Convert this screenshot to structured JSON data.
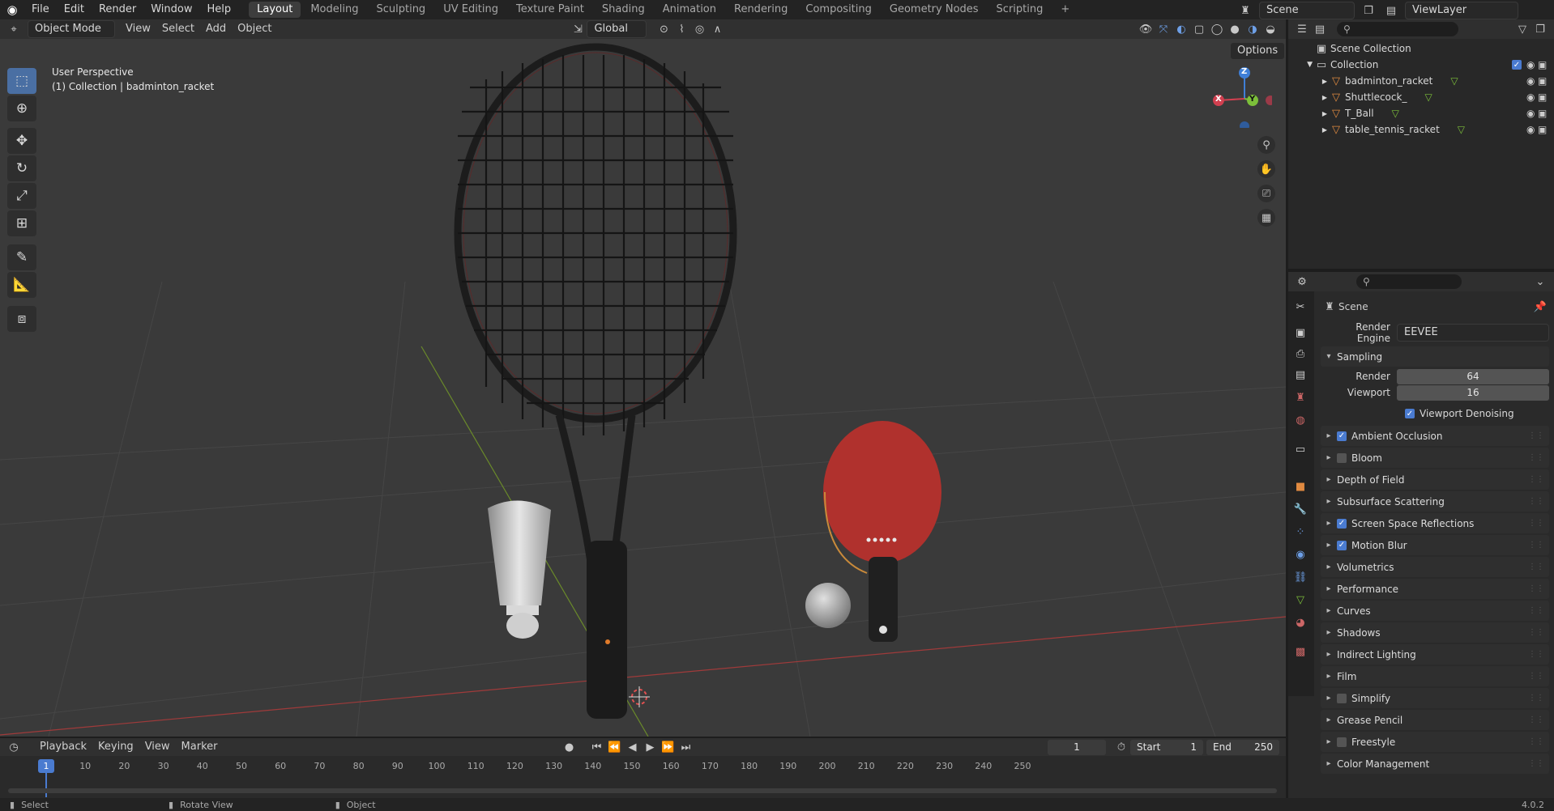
{
  "topbar": {
    "menus": [
      "File",
      "Edit",
      "Render",
      "Window",
      "Help"
    ],
    "workspaces": [
      "Layout",
      "Modeling",
      "Sculpting",
      "UV Editing",
      "Texture Paint",
      "Shading",
      "Animation",
      "Rendering",
      "Compositing",
      "Geometry Nodes",
      "Scripting"
    ],
    "active_workspace": "Layout",
    "scene": "Scene",
    "view_layer": "ViewLayer"
  },
  "viewport_header": {
    "mode": "Object Mode",
    "menus": [
      "View",
      "Select",
      "Add",
      "Object"
    ],
    "orientation": "Global",
    "options_label": "Options"
  },
  "viewport": {
    "perspective": "User Perspective",
    "collection_info": "(1) Collection | badminton_racket",
    "gizmo_axes": [
      "Z",
      "X",
      "Y"
    ]
  },
  "outliner": {
    "root": "Scene Collection",
    "collection": "Collection",
    "objects": [
      "badminton_racket",
      "Shuttlecock_",
      "T_Ball",
      "table_tennis_racket"
    ]
  },
  "properties": {
    "context": "Scene",
    "render_engine_label": "Render Engine",
    "render_engine": "EEVEE",
    "sampling_label": "Sampling",
    "render_label": "Render",
    "render_samples": "64",
    "viewport_label": "Viewport",
    "viewport_samples": "16",
    "viewport_denoising": "Viewport Denoising",
    "panels": [
      {
        "label": "Ambient Occlusion",
        "checkbox": true,
        "checked": true
      },
      {
        "label": "Bloom",
        "checkbox": true,
        "checked": false
      },
      {
        "label": "Depth of Field",
        "checkbox": false,
        "checked": false
      },
      {
        "label": "Subsurface Scattering",
        "checkbox": false,
        "checked": false
      },
      {
        "label": "Screen Space Reflections",
        "checkbox": true,
        "checked": true
      },
      {
        "label": "Motion Blur",
        "checkbox": true,
        "checked": true
      },
      {
        "label": "Volumetrics",
        "checkbox": false,
        "checked": false
      },
      {
        "label": "Performance",
        "checkbox": false,
        "checked": false
      },
      {
        "label": "Curves",
        "checkbox": false,
        "checked": false
      },
      {
        "label": "Shadows",
        "checkbox": false,
        "checked": false
      },
      {
        "label": "Indirect Lighting",
        "checkbox": false,
        "checked": false
      },
      {
        "label": "Film",
        "checkbox": false,
        "checked": false
      },
      {
        "label": "Simplify",
        "checkbox": true,
        "checked": false
      },
      {
        "label": "Grease Pencil",
        "checkbox": false,
        "checked": false
      },
      {
        "label": "Freestyle",
        "checkbox": true,
        "checked": false
      },
      {
        "label": "Color Management",
        "checkbox": false,
        "checked": false
      }
    ]
  },
  "timeline": {
    "menus": [
      "Playback",
      "Keying",
      "View",
      "Marker"
    ],
    "current_frame": "1",
    "start_label": "Start",
    "start": "1",
    "end_label": "End",
    "end": "250",
    "ticks": [
      "10",
      "20",
      "30",
      "40",
      "50",
      "60",
      "70",
      "80",
      "90",
      "100",
      "110",
      "120",
      "130",
      "140",
      "150",
      "160",
      "170",
      "180",
      "190",
      "200",
      "210",
      "220",
      "230",
      "240",
      "250"
    ],
    "playhead": "1"
  },
  "statusbar": {
    "select": "Select",
    "rotate": "Rotate View",
    "object": "Object",
    "version": "4.0.2"
  },
  "colors": {
    "accent": "#4a7bd0",
    "axis_x": "#d14050",
    "axis_y": "#7cbf3a",
    "axis_z": "#3f7fd6",
    "paddle_red": "#b0312d"
  }
}
